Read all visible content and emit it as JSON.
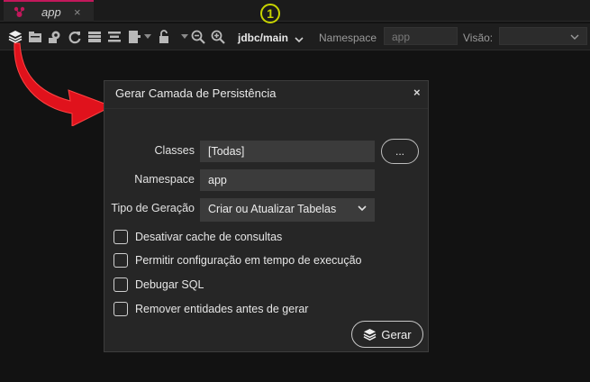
{
  "tab": {
    "label": "app",
    "close": "×"
  },
  "toolbar": {
    "connection": "jdbc/main",
    "badge": "1",
    "namespace_label": "Namespace",
    "namespace_value": "app",
    "view_label": "Visão:",
    "view_value": ""
  },
  "dialog": {
    "title": "Gerar Camada de Persistência",
    "close": "×",
    "classes_label": "Classes",
    "classes_value": "[Todas]",
    "dots_label": "...",
    "namespace_label": "Namespace",
    "namespace_value": "app",
    "generation_label": "Tipo de Geração",
    "generation_value": "Criar ou Atualizar Tabelas",
    "options": [
      {
        "label": "Desativar cache de consultas",
        "checked": false
      },
      {
        "label": "Permitir configuração em tempo de execução",
        "checked": false
      },
      {
        "label": "Debugar SQL",
        "checked": false
      },
      {
        "label": "Remover entidades antes de gerar",
        "checked": false
      }
    ],
    "generate_label": "Gerar"
  },
  "colors": {
    "accent": "#c2185b",
    "badge": "#c8d400",
    "arrow": "#e0121c",
    "dialog_bg": "#262626",
    "field_bg": "#3b3b3b"
  }
}
